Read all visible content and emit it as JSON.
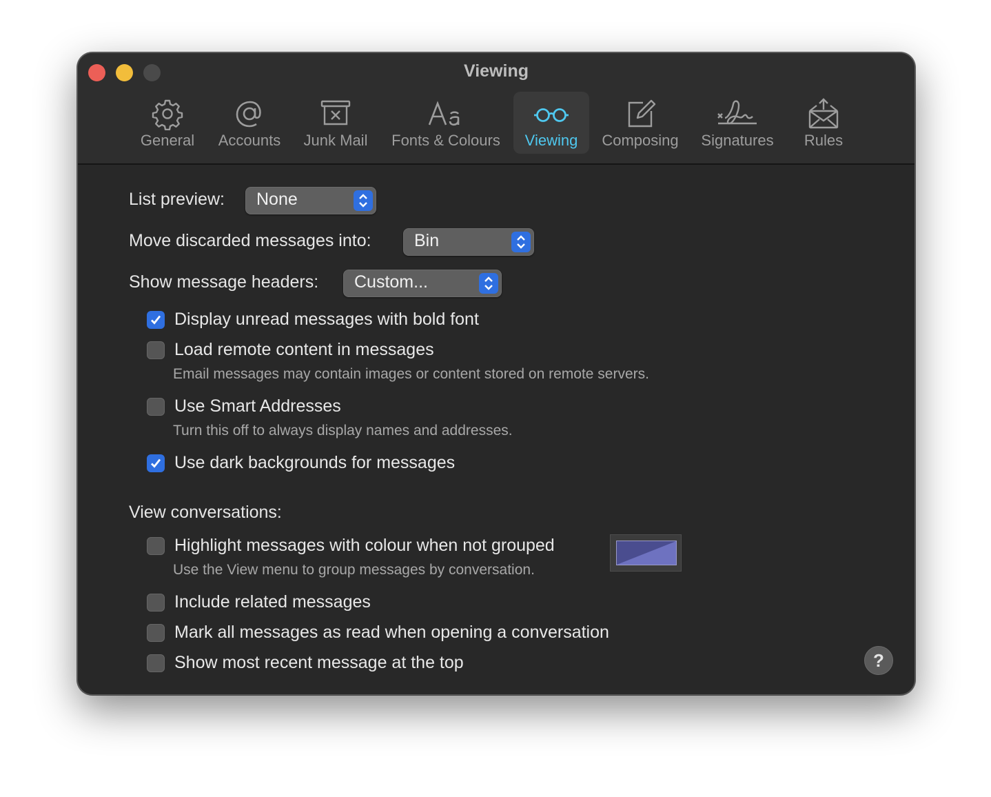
{
  "window": {
    "title": "Viewing"
  },
  "toolbar": {
    "items": [
      {
        "label": "General",
        "icon": "gear-icon"
      },
      {
        "label": "Accounts",
        "icon": "at-icon"
      },
      {
        "label": "Junk Mail",
        "icon": "junk-icon"
      },
      {
        "label": "Fonts & Colours",
        "icon": "fonts-icon"
      },
      {
        "label": "Viewing",
        "icon": "glasses-icon",
        "active": true
      },
      {
        "label": "Composing",
        "icon": "compose-icon"
      },
      {
        "label": "Signatures",
        "icon": "signature-icon"
      },
      {
        "label": "Rules",
        "icon": "rules-icon"
      }
    ]
  },
  "settings": {
    "list_preview": {
      "label": "List preview:",
      "value": "None"
    },
    "discarded": {
      "label": "Move discarded messages into:",
      "value": "Bin"
    },
    "headers": {
      "label": "Show message headers:",
      "value": "Custom..."
    },
    "bold_unread": {
      "label": "Display unread messages with bold font",
      "checked": true
    },
    "remote_content": {
      "label": "Load remote content in messages",
      "hint": "Email messages may contain images or content stored on remote servers.",
      "checked": false
    },
    "smart_addresses": {
      "label": "Use Smart Addresses",
      "hint": "Turn this off to always display names and addresses.",
      "checked": false
    },
    "dark_backgrounds": {
      "label": "Use dark backgrounds for messages",
      "checked": true
    }
  },
  "conversations": {
    "title": "View conversations:",
    "highlight": {
      "label": "Highlight messages with colour when not grouped",
      "hint": "Use the View menu to group messages by conversation.",
      "checked": false,
      "color": "#5b5fa6"
    },
    "related": {
      "label": "Include related messages",
      "checked": false
    },
    "mark_read": {
      "label": "Mark all messages as read when opening a conversation",
      "checked": false
    },
    "recent_top": {
      "label": "Show most recent message at the top",
      "checked": false
    }
  },
  "help": {
    "label": "?"
  },
  "colors": {
    "accent": "#4fc8ef",
    "checkbox_on": "#2f6fe0"
  }
}
